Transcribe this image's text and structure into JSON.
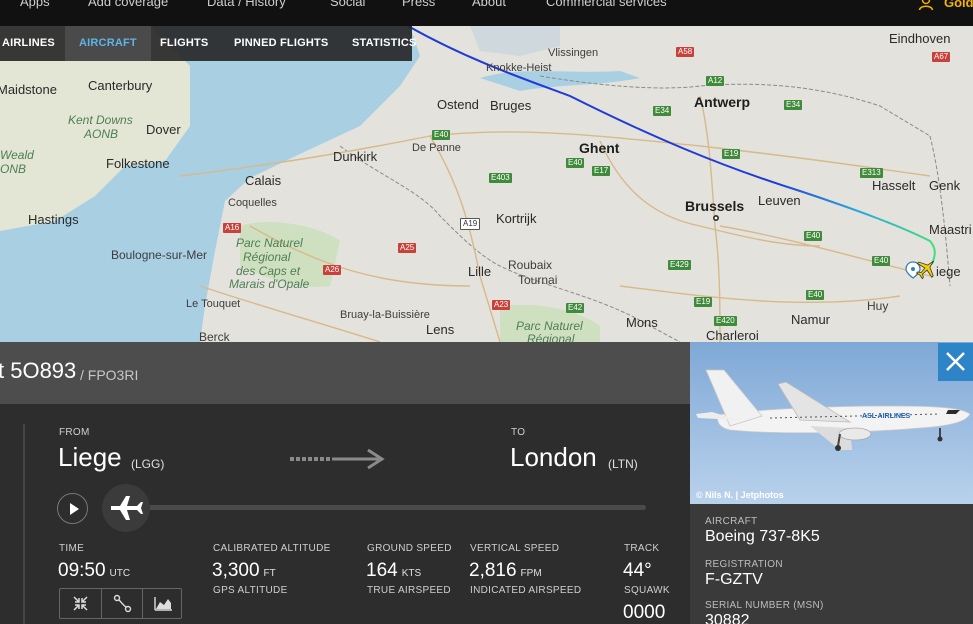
{
  "topnav": {
    "items": [
      "Apps",
      "Add coverage",
      "Data / History",
      "Social",
      "Press",
      "About",
      "Commercial services"
    ],
    "user_label": "Gold"
  },
  "tabs": [
    "AIRLINES",
    "AIRCRAFT",
    "FLIGHTS",
    "PINNED FLIGHTS",
    "STATISTICS"
  ],
  "map": {
    "places": {
      "maidstone": "Maidstone",
      "canterbury": "Canterbury",
      "kent_downs": "Kent Downs",
      "aonb": "AONB",
      "dover": "Dover",
      "weald": "Weald",
      "onb": "ONB",
      "folkestone": "Folkestone",
      "calais": "Calais",
      "coquelles": "Coquelles",
      "hastings": "Hastings",
      "boulogne": "Boulogne-sur-Mer",
      "le_touquet": "Le Touquet",
      "berck": "Berck",
      "parc1": "Parc Naturel",
      "parc2": "Régional",
      "parc3": "des Caps et",
      "parc4": "Marais d'Opale",
      "dunkirk": "Dunkirk",
      "de_panne": "De Panne",
      "ostend": "Ostend",
      "bruges": "Bruges",
      "knokke": "Knokke-Heist",
      "vlissingen": "Vlissingen",
      "antwerp": "Antwerp",
      "ghent": "Ghent",
      "kortrijk": "Kortrijk",
      "lille": "Lille",
      "roubaix": "Roubaix",
      "tournai": "Tournai",
      "bruay": "Bruay-la-Buissière",
      "lens": "Lens",
      "parc_scarpe1": "Parc Naturel",
      "parc_scarpe2": "Régional",
      "brussels": "Brussels",
      "leuven": "Leuven",
      "hasselt": "Hasselt",
      "genk": "Genk",
      "eindhoven": "Eindhoven",
      "maastricht": "Maastri",
      "liege": "iege",
      "huy": "Huy",
      "namur": "Namur",
      "mons": "Mons",
      "charleroi": "Charleroi"
    },
    "roads": [
      "A58",
      "A12",
      "E34",
      "E34",
      "A67",
      "E40",
      "E40",
      "E17",
      "E19",
      "E403",
      "A19",
      "E313",
      "E40",
      "A16",
      "A25",
      "A26",
      "E429",
      "E40",
      "A23",
      "E42",
      "E19",
      "E420",
      "E40"
    ]
  },
  "flight": {
    "number": "t 5O893",
    "callsign": "/ FPO3RI"
  },
  "route": {
    "from_label": "FROM",
    "from_city": "Liege",
    "from_code": "(LGG)",
    "to_label": "TO",
    "to_city": "London",
    "to_code": "(LTN)"
  },
  "progress_fraction": 0.0,
  "stats": {
    "time_label": "TIME",
    "time_value": "09:50",
    "time_unit": "UTC",
    "calt_label": "CALIBRATED ALTITUDE",
    "calt_value": "3,300",
    "calt_unit": "FT",
    "gps_label": "GPS ALTITUDE",
    "gs_label": "GROUND SPEED",
    "gs_value": "164",
    "gs_unit": "KTS",
    "tas_label": "TRUE AIRSPEED",
    "vs_label": "VERTICAL SPEED",
    "vs_value": "2,816",
    "vs_unit": "FPM",
    "ias_label": "INDICATED AIRSPEED",
    "track_label": "TRACK",
    "track_value": "44°",
    "squawk_label": "SQUAWK",
    "squawk_value": "0000"
  },
  "photo_credit": "© Nils N. | Jetphotos",
  "photo_livery": "ASL AIRLINES",
  "aircraft": {
    "type_label": "AIRCRAFT",
    "type_value": "Boeing 737-8K5",
    "reg_label": "REGISTRATION",
    "reg_value": "F-GZTV",
    "msn_label": "SERIAL NUMBER (MSN)",
    "msn_value": "30882"
  },
  "colors": {
    "accent": "#2d85c8",
    "active_tab": "#5fb4e6",
    "track_start": "#1f3bd6",
    "track_end": "#3ee07a",
    "gold": "#f5b301"
  },
  "icons": [
    "user-icon",
    "play-icon",
    "plane-icon",
    "arrow-right-icon",
    "expand-icon",
    "route-icon",
    "chart-icon",
    "close-icon"
  ]
}
